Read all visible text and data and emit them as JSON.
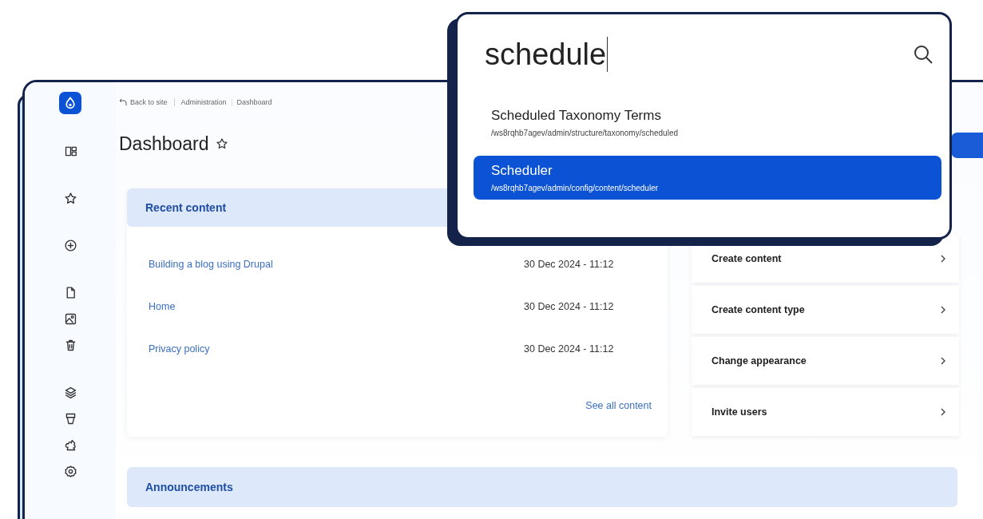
{
  "breadcrumb": {
    "back": "Back to site",
    "items": [
      "Administration",
      "Dashboard"
    ]
  },
  "page_title": "Dashboard",
  "recent_content": {
    "title": "Recent content",
    "rows": [
      {
        "title": "Building a blog using Drupal",
        "date": "30 Dec 2024 - 11:12"
      },
      {
        "title": "Home",
        "date": "30 Dec 2024 - 11:12"
      },
      {
        "title": "Privacy policy",
        "date": "30 Dec 2024 - 11:12"
      }
    ],
    "see_all": "See all content"
  },
  "quick_links": [
    "Create content",
    "Create content type",
    "Change appearance",
    "Invite users"
  ],
  "announcements": {
    "title": "Announcements"
  },
  "search": {
    "value": "schedule",
    "results": [
      {
        "title": "Scheduled Taxonomy Terms",
        "path": "/ws8rqhb7agev/admin/structure/taxonomy/scheduled",
        "selected": false
      },
      {
        "title": "Scheduler",
        "path": "/ws8rqhb7agev/admin/config/content/scheduler",
        "selected": true
      }
    ]
  }
}
